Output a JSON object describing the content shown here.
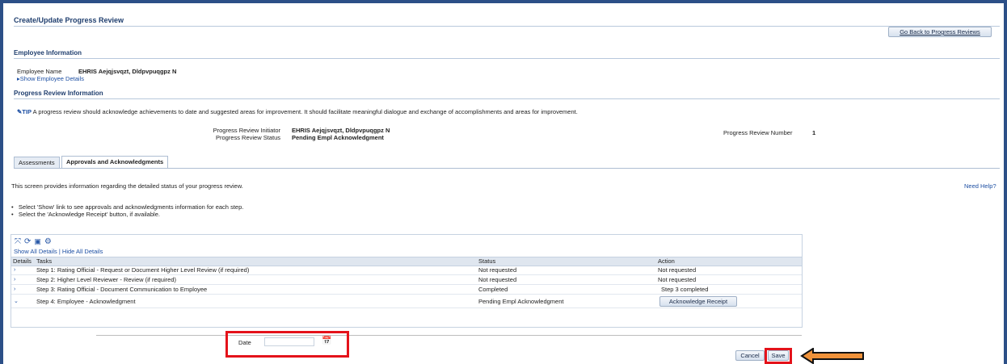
{
  "page": {
    "title": "Create/Update Progress Review",
    "go_back_label": "Go Back to Progress Reviews"
  },
  "employee_info": {
    "section_title": "Employee Information",
    "name_label": "Employee Name",
    "name_value": "EHRIS Aejqjsvqzt, Dldpvpuqgpz N",
    "show_details_link": "Show Employee Details"
  },
  "review_info": {
    "section_title": "Progress Review Information",
    "tip_label": "TIP",
    "tip_text": "A progress review should acknowledge achievements to date and suggested areas for improvement. It should facilitate meaningful dialogue and exchange of accomplishments and areas for improvement.",
    "initiator_label": "Progress Review Initiator",
    "initiator_value": "EHRIS Aejqjsvqzt, Dldpvpuqgpz N",
    "status_label": "Progress Review Status",
    "status_value": "Pending Empl Acknowledgment",
    "number_label": "Progress Review Number",
    "number_value": "1"
  },
  "tabs": [
    {
      "label": "Assessments",
      "active": false
    },
    {
      "label": "Approvals and Acknowledgments",
      "active": true
    }
  ],
  "content": {
    "intro": "This screen provides information regarding the detailed status of your progress review.",
    "need_help": "Need Help?",
    "bullet_1": "Select 'Show' link to see approvals and acknowledgments information for each step.",
    "bullet_2": "Select the 'Acknowledge Receipt' button, if available."
  },
  "table": {
    "show_all": "Show All Details",
    "separator": "|",
    "hide_all": "Hide All Details",
    "columns": [
      "Details",
      "Tasks",
      "Status",
      "Action"
    ],
    "rows": [
      {
        "expander": "›",
        "task": "Step 1:  Rating Official - Request or Document Higher Level Review (if required)",
        "status": "Not requested",
        "action": "Not requested"
      },
      {
        "expander": "›",
        "task": "Step 2:  Higher Level Reviewer - Review (if required)",
        "status": "Not requested",
        "action": "Not requested"
      },
      {
        "expander": "›",
        "task": "Step 3:  Rating Official - Document Communication to Employee",
        "status": "Completed",
        "action": "Step 3 completed"
      },
      {
        "expander": "⌄",
        "task": "Step 4:  Employee - Acknowledgment",
        "status": "Pending Empl Acknowledgment",
        "action_button": "Acknowledge Receipt"
      }
    ]
  },
  "form": {
    "date_label": "Date",
    "date_value": "",
    "cancel_label": "Cancel",
    "save_label": "Save"
  },
  "colors": {
    "frame": "#2c4f87",
    "highlight_red": "#e4121a",
    "arrow_orange": "#f0923a"
  }
}
